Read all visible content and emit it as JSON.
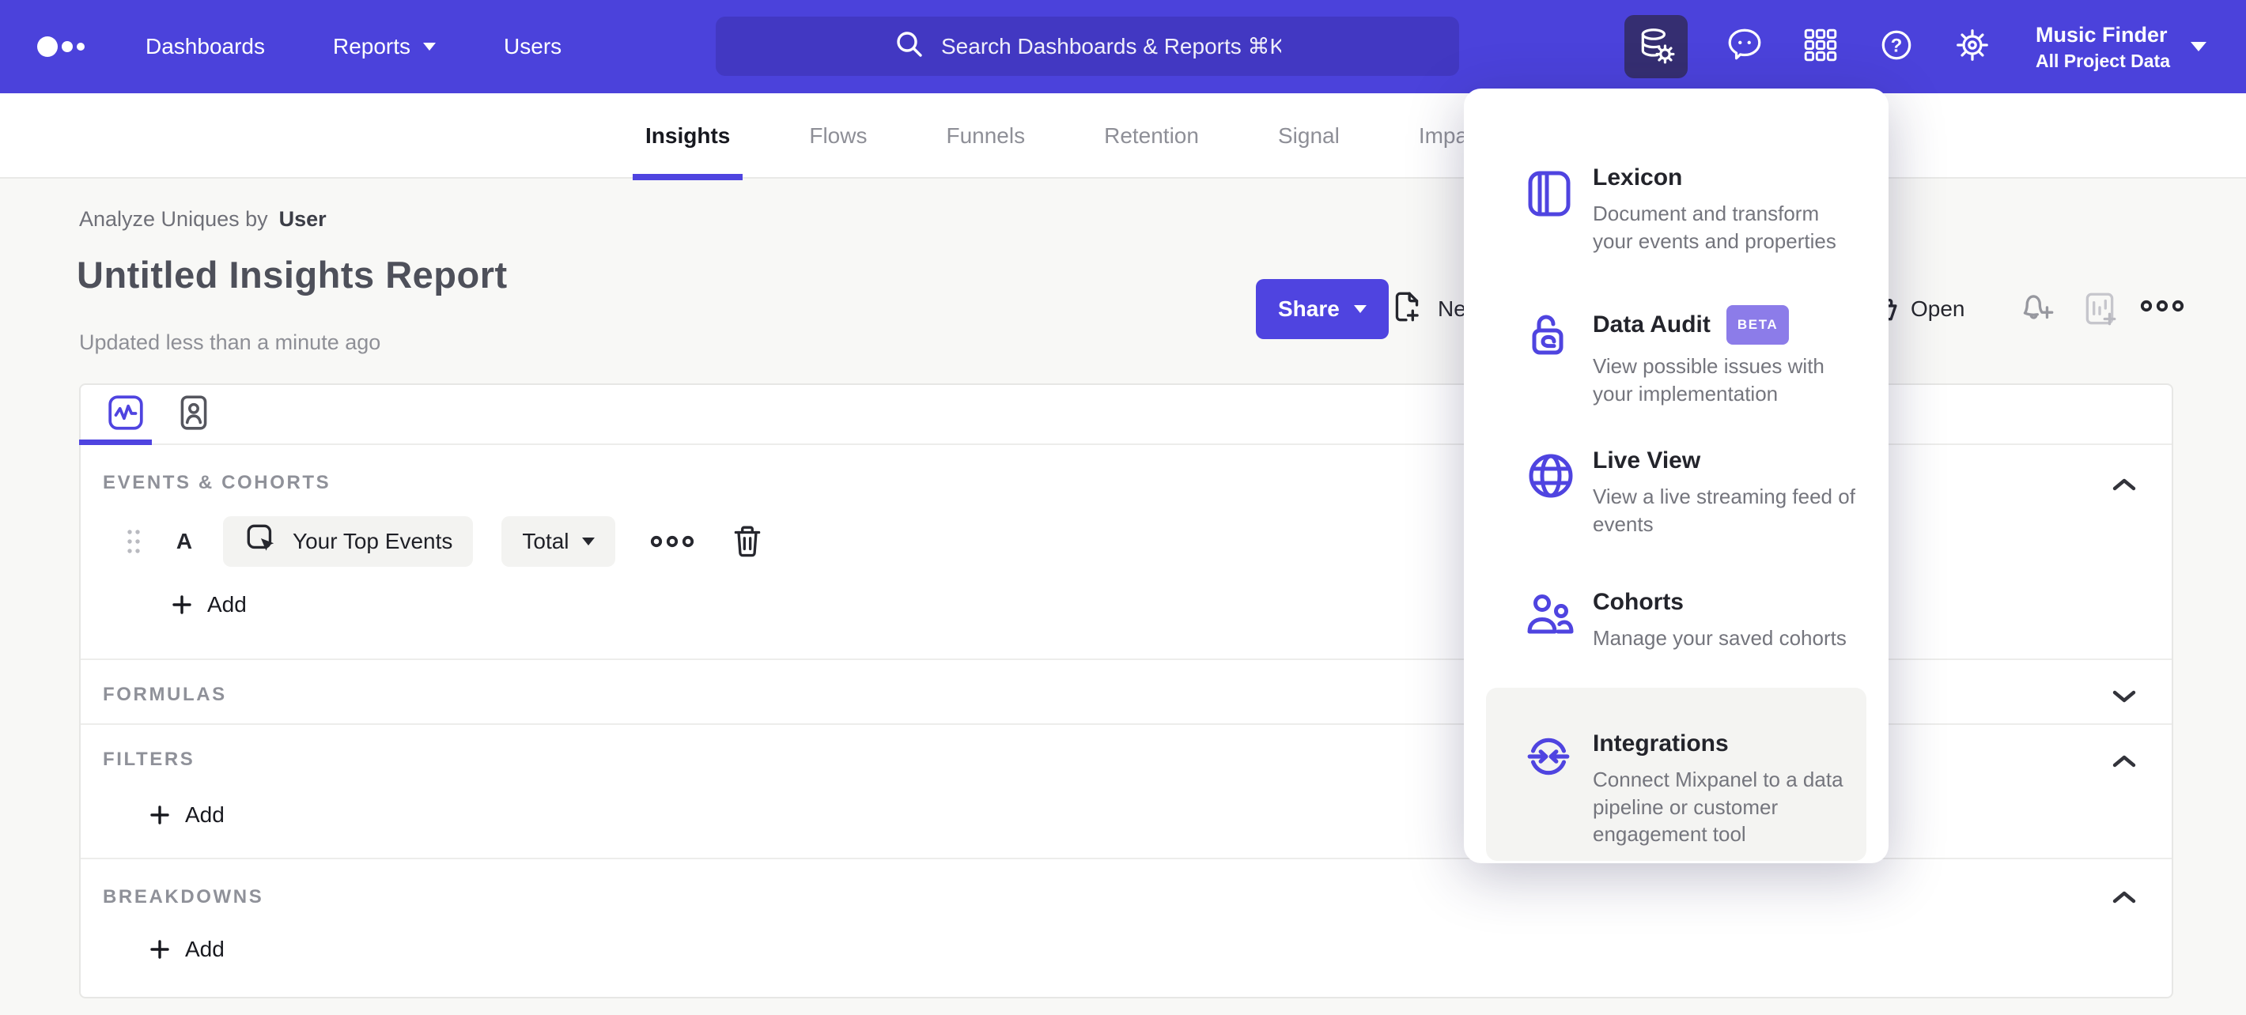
{
  "header": {
    "nav": [
      {
        "label": "Dashboards"
      },
      {
        "label": "Reports"
      },
      {
        "label": "Users"
      }
    ],
    "search_placeholder": "Search Dashboards & Reports ⌘K",
    "project": {
      "name": "Music Finder",
      "scope": "All Project Data"
    }
  },
  "tabs": {
    "items": [
      {
        "label": "Insights"
      },
      {
        "label": "Flows"
      },
      {
        "label": "Funnels"
      },
      {
        "label": "Retention"
      },
      {
        "label": "Signal"
      },
      {
        "label": "Impact"
      }
    ]
  },
  "report": {
    "analyze_prefix": "Analyze Uniques by",
    "analyze_value": "User",
    "title": "Untitled Insights Report",
    "updated": "Updated less than a minute ago",
    "share_label": "Share",
    "new_label": "New",
    "open_label": "Open"
  },
  "builder": {
    "sections": {
      "events": "EVENTS & COHORTS",
      "formulas": "FORMULAS",
      "filters": "FILTERS",
      "breakdowns": "BREAKDOWNS"
    },
    "row": {
      "letter": "A",
      "event_label": "Your Top Events",
      "metric_label": "Total"
    },
    "add_label": "Add"
  },
  "menu": {
    "items": [
      {
        "title": "Lexicon",
        "desc": "Document and transform your events and properties"
      },
      {
        "title": "Data Audit",
        "badge": "BETA",
        "desc": "View possible issues with your implementation"
      },
      {
        "title": "Live View",
        "desc": "View a live streaming feed of events"
      },
      {
        "title": "Cohorts",
        "desc": "Manage your saved cohorts"
      },
      {
        "title": "Integrations",
        "desc": "Connect Mixpanel to a data pipeline or customer engagement tool"
      }
    ]
  },
  "colors": {
    "brand": "#4F44E0",
    "header": "#4B42DB",
    "badge": "#8C7CE9"
  }
}
